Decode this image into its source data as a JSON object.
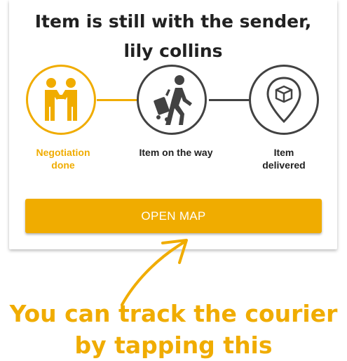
{
  "status": {
    "title": "Item is still with the sender, lily collins"
  },
  "steps": [
    {
      "label": "Negotiation done",
      "icon": "handshake-icon",
      "state": "done"
    },
    {
      "label": "Item on the way",
      "icon": "traveler-with-luggage-icon",
      "state": "pending"
    },
    {
      "label": "Item delivered",
      "icon": "location-pin-box-icon",
      "state": "pending"
    }
  ],
  "actions": {
    "open_map_label": "OPEN MAP"
  },
  "annotation": {
    "hint": "You can track the courier by tapping this"
  },
  "colors": {
    "accent": "#f0ac00",
    "pending": "#424242",
    "text": "#212121"
  }
}
